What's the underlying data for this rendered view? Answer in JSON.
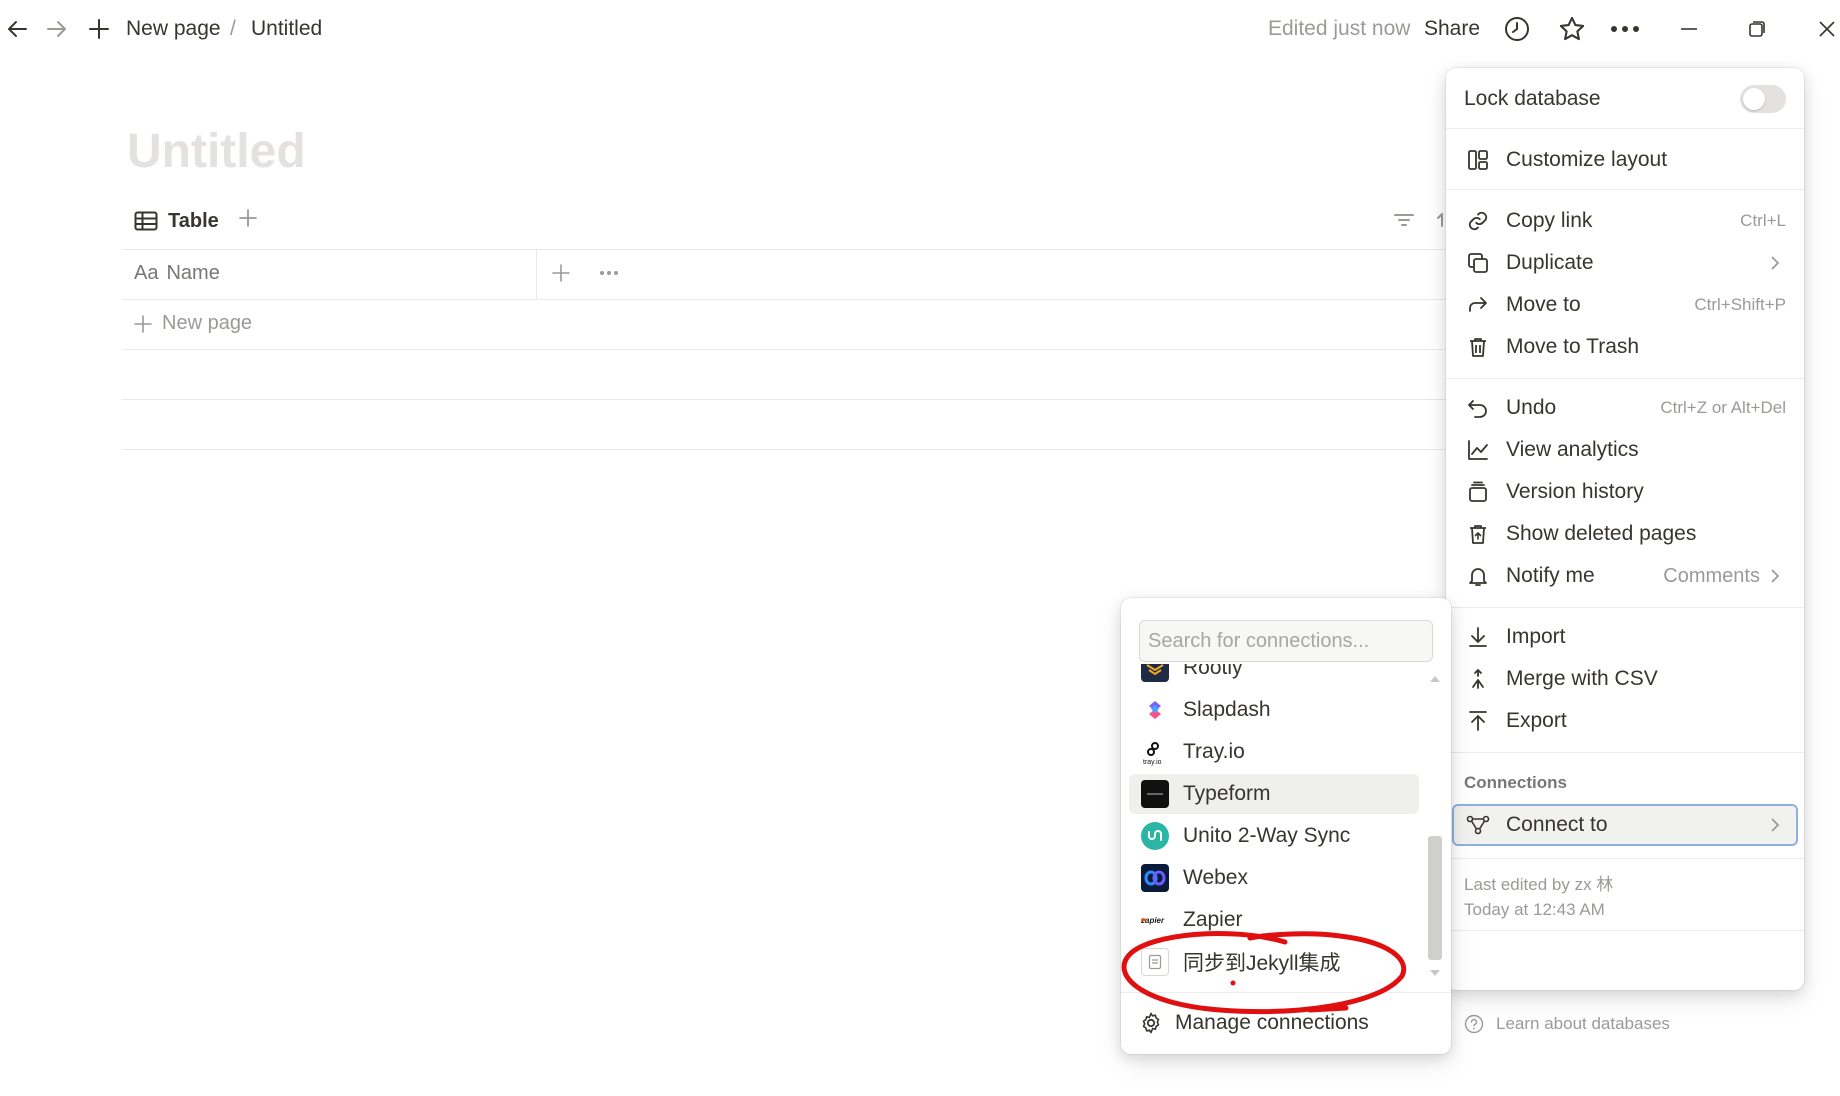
{
  "topbar": {
    "breadcrumb_new_page": "New page",
    "breadcrumb_sep": "/",
    "breadcrumb_current": "Untitled",
    "edited_status": "Edited just now",
    "share_label": "Share"
  },
  "page": {
    "title": "Untitled",
    "view_tab_label": "Table",
    "column_prefix": "Aa",
    "column_name": "Name",
    "new_row_label": "New page"
  },
  "menu": {
    "lock_label": "Lock database",
    "lock_on": false,
    "customize_layout": "Customize layout",
    "copy_link": "Copy link",
    "copy_link_shortcut": "Ctrl+L",
    "duplicate": "Duplicate",
    "move_to": "Move to",
    "move_to_shortcut": "Ctrl+Shift+P",
    "move_to_trash": "Move to Trash",
    "undo": "Undo",
    "undo_shortcut": "Ctrl+Z or Alt+Del",
    "view_analytics": "View analytics",
    "version_history": "Version history",
    "show_deleted": "Show deleted pages",
    "notify_me": "Notify me",
    "notify_value": "Comments",
    "import": "Import",
    "merge_csv": "Merge with CSV",
    "export": "Export",
    "connections_section": "Connections",
    "connect_to": "Connect to",
    "last_edited_by": "Last edited by zx 林",
    "last_edited_time": "Today at 12:43 AM",
    "learn": "Learn about databases"
  },
  "connections": {
    "search_placeholder": "Search for connections...",
    "items": [
      {
        "label": "Rootly",
        "icon": "rootly-logo"
      },
      {
        "label": "Slapdash",
        "icon": "slapdash-logo"
      },
      {
        "label": "Tray.io",
        "icon": "trayio-logo"
      },
      {
        "label": "Typeform",
        "icon": "typeform-logo"
      },
      {
        "label": "Unito 2-Way Sync",
        "icon": "unito-logo"
      },
      {
        "label": "Webex",
        "icon": "webex-logo"
      },
      {
        "label": "Zapier",
        "icon": "zapier-logo"
      },
      {
        "label": "同步到Jekyll集成",
        "icon": "page-icon"
      }
    ],
    "highlighted": "Typeform",
    "manage_label": "Manage connections"
  },
  "colors": {
    "text": "#37352f",
    "muted": "#9b9a97",
    "title_placeholder": "#e3e2e0",
    "connect_outline": "#8fb1e0",
    "annotation": "#e01010"
  }
}
